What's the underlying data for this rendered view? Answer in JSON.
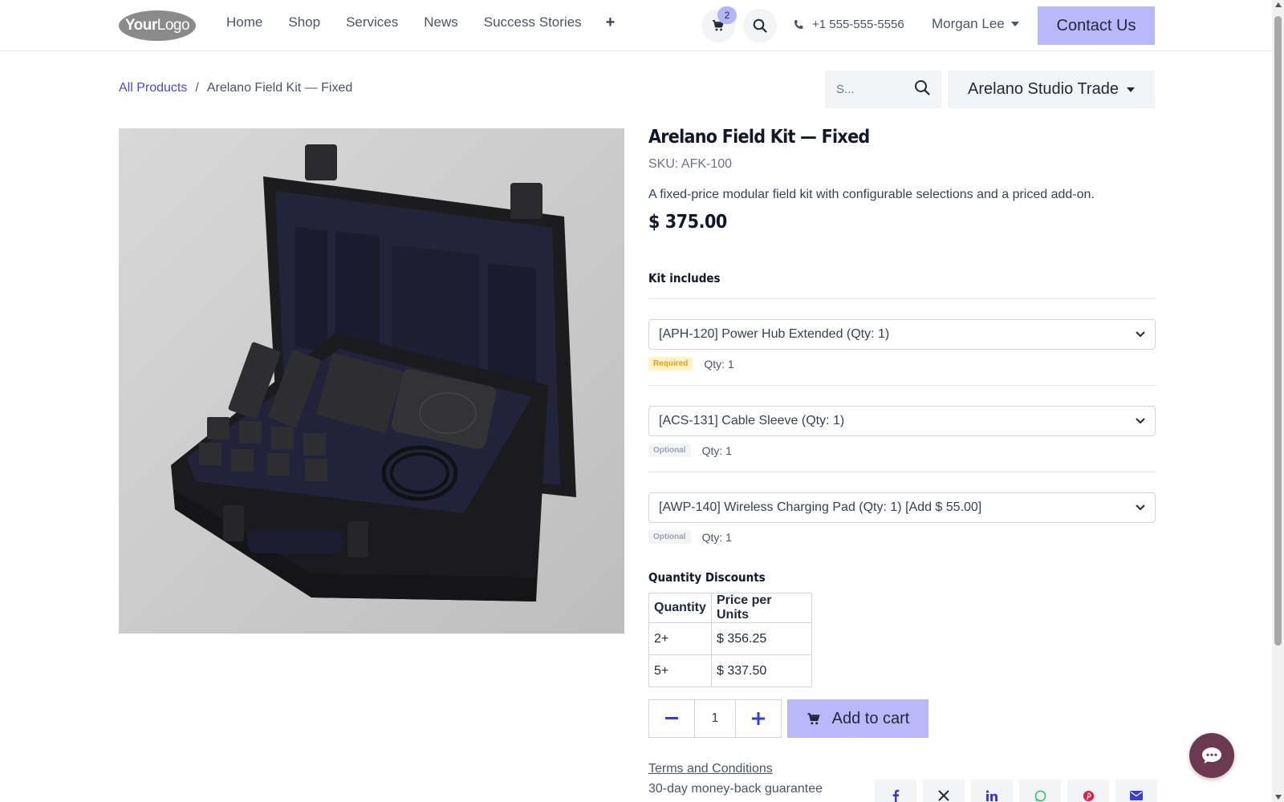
{
  "header": {
    "logo_bold": "Your",
    "logo_light": "Logo",
    "nav": [
      {
        "label": "Home"
      },
      {
        "label": "Shop"
      },
      {
        "label": "Services"
      },
      {
        "label": "News"
      },
      {
        "label": "Success Stories"
      }
    ],
    "nav_more": "+",
    "cart_count": "2",
    "phone": "+1 555-555-5556",
    "user": "Morgan Lee",
    "contact_label": "Contact Us"
  },
  "breadcrumb": {
    "root": "All Products",
    "separator": "/",
    "current": "Arelano Field Kit — Fixed"
  },
  "search": {
    "placeholder": "S..."
  },
  "pricelist": {
    "label": "Arelano Studio Trade"
  },
  "product": {
    "title": "Arelano Field Kit — Fixed",
    "sku": "SKU: AFK-100",
    "description": "A fixed-price modular field kit with configurable selections and a priced add-on.",
    "price": "$ 375.00",
    "kit_title": "Kit includes",
    "kit_items": [
      {
        "selection": "[APH-120] Power Hub Extended (Qty: 1)",
        "tag": "Required",
        "qty": "Qty: 1"
      },
      {
        "selection": "[ACS-131] Cable Sleeve (Qty: 1)",
        "tag": "Optional",
        "qty": "Qty: 1"
      },
      {
        "selection": "[AWP-140] Wireless Charging Pad (Qty: 1) [Add $ 55.00]",
        "tag": "Optional",
        "qty": "Qty: 1"
      }
    ],
    "discounts_title": "Quantity Discounts",
    "discounts_headers": [
      "Quantity",
      "Price per Units"
    ],
    "discounts_rows": [
      [
        "2+",
        "$ 356.25"
      ],
      [
        "5+",
        "$ 337.50"
      ]
    ],
    "quantity": "1",
    "add_to_cart": "Add to cart",
    "terms": "Terms and Conditions",
    "guarantee": "30-day money-back guarantee"
  },
  "colors": {
    "accent": "#b8b8fb",
    "link": "#4f46e5",
    "chat": "#6b3a52"
  },
  "icons": {
    "cart": "cart-icon",
    "search": "search-icon",
    "phone": "phone-icon",
    "share": [
      "facebook-icon",
      "x-icon",
      "linkedin-icon",
      "whatsapp-icon",
      "pinterest-icon",
      "email-icon"
    ],
    "chat": "chat-icon"
  }
}
